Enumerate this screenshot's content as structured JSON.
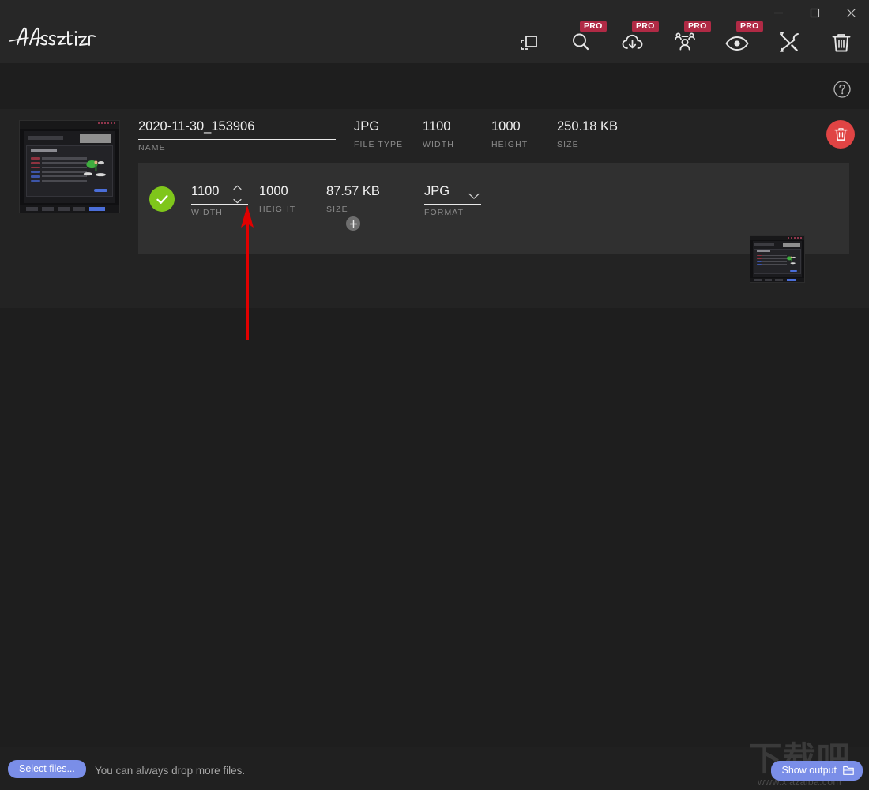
{
  "app": {
    "name": "Assetizr",
    "logo_text": "Assetizr"
  },
  "window_controls": {
    "minimize": "minimize-icon",
    "maximize": "maximize-icon",
    "close": "close-icon"
  },
  "toolbar": {
    "items": [
      {
        "icon": "resize-crop-icon",
        "label": "Resize and crop",
        "pro": false,
        "pro_label": "PRO"
      },
      {
        "icon": "search-magnify-icon",
        "label": "Smart search",
        "pro": true,
        "pro_label": "PRO"
      },
      {
        "icon": "cloud-download-icon",
        "label": "Cloud download",
        "pro": true,
        "pro_label": "PRO"
      },
      {
        "icon": "team-users-icon",
        "label": "Team",
        "pro": true,
        "pro_label": "PRO"
      },
      {
        "icon": "eye-preview-icon",
        "label": "Preview",
        "pro": true,
        "pro_label": "PRO"
      },
      {
        "icon": "tools-icon",
        "label": "Tools",
        "pro": false,
        "pro_label": "PRO"
      },
      {
        "icon": "trash-icon",
        "label": "Clear all",
        "pro": false,
        "pro_label": "PRO"
      }
    ]
  },
  "help": {
    "icon": "question-circle-icon"
  },
  "file": {
    "thumbnail_alt": "source image thumbnail",
    "name": {
      "value": "2020-11-30_153906",
      "label": "NAME"
    },
    "file_type": {
      "value": "JPG",
      "label": "FILE TYPE"
    },
    "width": {
      "value": "1100",
      "label": "WIDTH"
    },
    "height": {
      "value": "1000",
      "label": "HEIGHT"
    },
    "size": {
      "value": "250.18 KB",
      "label": "SIZE"
    },
    "delete_icon": "trash-icon"
  },
  "output": {
    "status_icon": "check-circle-icon",
    "width": {
      "value": "1100",
      "label": "WIDTH"
    },
    "height": {
      "value": "1000",
      "label": "HEIGHT"
    },
    "size": {
      "value": "87.57 KB",
      "label": "SIZE"
    },
    "format": {
      "value": "JPG",
      "label": "FORMAT",
      "caret_icon": "chevron-down-icon"
    },
    "spinner": {
      "up_icon": "chevron-up-icon",
      "down_icon": "chevron-down-icon"
    },
    "preview_thumbnail_alt": "output image preview",
    "add_preset_icon": "plus-icon"
  },
  "annotation": {
    "arrow_color": "#e00000",
    "points_to": "output-width-stepper"
  },
  "bottom_bar": {
    "select_files_label": "Select files...",
    "drop_hint": "You can always drop more files.",
    "show_output_label": "Show output",
    "show_output_icon": "folder-open-icon"
  },
  "watermark": {
    "cn_text": "下载吧",
    "url_text": "www.xiazaiba.com"
  },
  "colors": {
    "window_bg": "#1e1e1e",
    "titlebar_bg": "#272727",
    "card_bg": "#232323",
    "strip_bg": "#303030",
    "accent_blue": "#7a8ee8",
    "pro_badge": "#b02a45",
    "delete_red": "#e04444",
    "status_green": "#7fc61b",
    "label_gray": "#8c8c8c"
  }
}
